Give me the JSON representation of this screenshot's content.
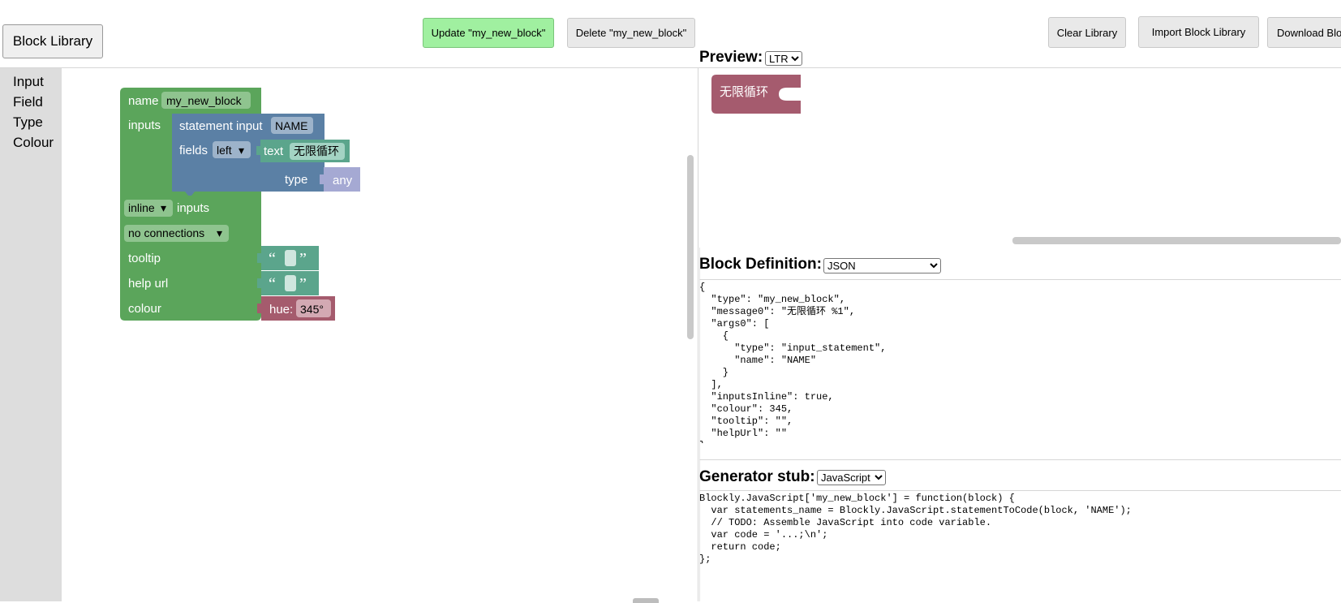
{
  "header": {
    "block_library_button": "Block Library",
    "update_button": "Update \"my_new_block\"",
    "delete_button": "Delete \"my_new_block\"",
    "clear_library_button": "Clear Library",
    "import_library_button": "Import Block Library",
    "download_library_button": "Download Block Library"
  },
  "toolbox": {
    "items": [
      {
        "label": "Input"
      },
      {
        "label": "Field"
      },
      {
        "label": "Type"
      },
      {
        "label": "Colour"
      }
    ]
  },
  "workspace": {
    "factory_block": {
      "name_label": "name",
      "name_value": "my_new_block",
      "inputs_label": "inputs",
      "inline_dropdown": "inline",
      "inputs_suffix": "inputs",
      "connections_dropdown": "no connections",
      "tooltip_label": "tooltip",
      "help_url_label": "help url",
      "colour_label": "colour"
    },
    "statement_input_block": {
      "label": "statement input",
      "name_value": "NAME",
      "fields_label": "fields",
      "align_dropdown": "left",
      "type_label": "type"
    },
    "text_field_block": {
      "label": "text",
      "value": "无限循环"
    },
    "type_block": {
      "label": "any"
    },
    "string_blocks": {
      "open_quote": "“",
      "close_quote": "”"
    },
    "hue_block": {
      "label": "hue:",
      "value": "345°"
    },
    "colors": {
      "factory_green": "#5ba55b",
      "input_blue": "#5b80a5",
      "field_teal": "#5ba58c",
      "type_lavender": "#a5a9d3",
      "hue_red": "#a55b6d",
      "preview_block": "#a55b6e"
    }
  },
  "preview": {
    "label": "Preview:",
    "direction_selected": "LTR",
    "block_text": "无限循环"
  },
  "block_definition": {
    "label": "Block Definition:",
    "format_selected": "JSON",
    "code": "{\n  \"type\": \"my_new_block\",\n  \"message0\": \"无限循环 %1\",\n  \"args0\": [\n    {\n      \"type\": \"input_statement\",\n      \"name\": \"NAME\"\n    }\n  ],\n  \"inputsInline\": true,\n  \"colour\": 345,\n  \"tooltip\": \"\",\n  \"helpUrl\": \"\"\n}"
  },
  "generator": {
    "label": "Generator stub:",
    "language_selected": "JavaScript",
    "code": "Blockly.JavaScript['my_new_block'] = function(block) {\n  var statements_name = Blockly.JavaScript.statementToCode(block, 'NAME');\n  // TODO: Assemble JavaScript into code variable.\n  var code = '...;\\n';\n  return code;\n};"
  }
}
